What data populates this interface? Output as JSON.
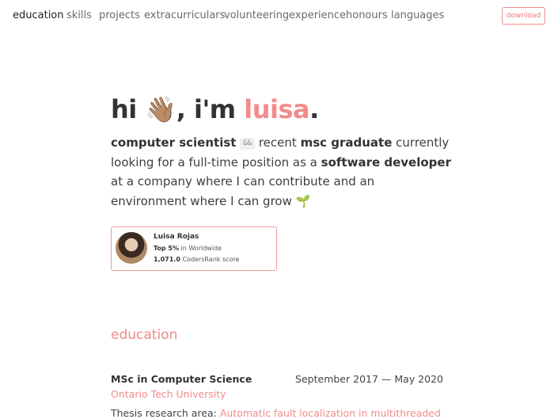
{
  "nav": {
    "items": [
      "education",
      "skills",
      "projects",
      "extracurriculars",
      "volunteering",
      "experience",
      "honours",
      "languages"
    ],
    "download_label": "download"
  },
  "hero": {
    "greeting": "hi",
    "emoji": "👋🏽",
    "im": ", i'm ",
    "name": "luisa",
    "period": "."
  },
  "intro": {
    "role": "computer scientist",
    "amp": "&&",
    "recent": "recent",
    "degree": "msc graduate",
    "looking": "currently looking for a full-time position as a",
    "position": "software developer",
    "rest": "at a company where I can contribute and an environment where I can grow",
    "emoji": "🌱"
  },
  "card": {
    "name": "Luisa Rojas",
    "rank": "Top 5%",
    "rank_suffix": "in Worldwide",
    "score": "1,071.0",
    "score_suffix": "CodersRank score"
  },
  "education": {
    "title": "education",
    "degree": "MSc in Computer Science",
    "dates": "September 2017 — May 2020",
    "school": "Ontario Tech University",
    "thesis_label": "Thesis research area:",
    "thesis_link": "Automatic fault localization in multithreaded"
  },
  "colors": {
    "accent": "#f28b8b"
  }
}
